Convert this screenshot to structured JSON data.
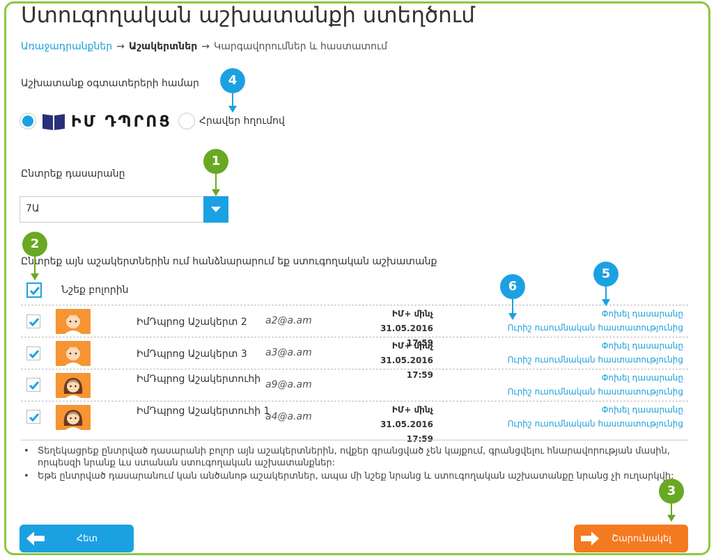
{
  "title": "Ստուգողական աշխատանքի ստեղծում",
  "breadcrumb": {
    "step1": "Առաջադրանքներ",
    "step2": "Աշակերտներ",
    "step3": "Կարգավորումներ և հաստատում"
  },
  "assignment_for_label": "Աշխատանք օգտատերերի համար",
  "option_im_dprots": "ԻՄ ԴՊՐՈՑ",
  "option_invite_link": "Հրավեր հղումով",
  "select_class_label": "Ընտրեք դասարանը",
  "selected_class": "7Ա",
  "select_students_label": "Ընտրեք այն աշակերտներին ում հանձնարարում եք ստուգողական աշխատանք",
  "select_all_label": "Նշեք բոլորին",
  "students": [
    {
      "name": "ԻմԴպրոց Աշակերտ 2",
      "email": "a2@a.am",
      "meta_line1": "ԻՄ+ մինչ 31.05.2016",
      "meta_line2": "17:59",
      "avatar": "boy",
      "checked": true
    },
    {
      "name": "ԻմԴպրոց Աշակերտ 3",
      "email": "a3@a.am",
      "meta_line1": "ԻՄ+ մինչ 31.05.2016",
      "meta_line2": "17:59",
      "avatar": "boy",
      "checked": true
    },
    {
      "name": "ԻմԴպրոց Աշակերտուհի",
      "email": "a9@a.am",
      "meta_line1": "",
      "meta_line2": "",
      "avatar": "girl",
      "checked": true
    },
    {
      "name": "ԻմԴպրոց Աշակերտուհի 1",
      "email": "a4@a.am",
      "meta_line1": "ԻՄ+ մինչ 31.05.2016",
      "meta_line2": "17:59",
      "avatar": "girl",
      "checked": true
    }
  ],
  "row_link_change_class": "Փոխել դասարանը",
  "row_link_remove_confirmation": "Ուրիշ ուսումնական հաստատությունից",
  "notes": [
    "Տեղեկացրեք ընտրված դասարանի բոլոր այն աշակերտներին, ովքեր գրանցված չեն կայքում, գրանցվելու հնարավորության մասին, որպեսզի նրանք ևս ստանան ստուգողական աշխատանքներ:",
    "Եթե ընտրված դասարանում կան անծանոթ աշակերտներ, ապա մի նշեք նրանց և ստուգողական աշխատանքը նրանց չի ուղարկվի:"
  ],
  "buttons": {
    "back": "Հետ",
    "next": "Շարունակել"
  },
  "callouts": [
    "1",
    "2",
    "3",
    "4",
    "5",
    "6"
  ],
  "colors": {
    "accent_blue": "#1ba1e2",
    "callout_green": "#6aa823",
    "next_orange": "#f47a20",
    "frame_green": "#8dc63f"
  },
  "icons": {
    "back": "arrow-left-icon",
    "next": "arrow-right-icon",
    "logo": "book-icon",
    "select": "chevron-down-icon",
    "check": "checkmark-icon"
  }
}
